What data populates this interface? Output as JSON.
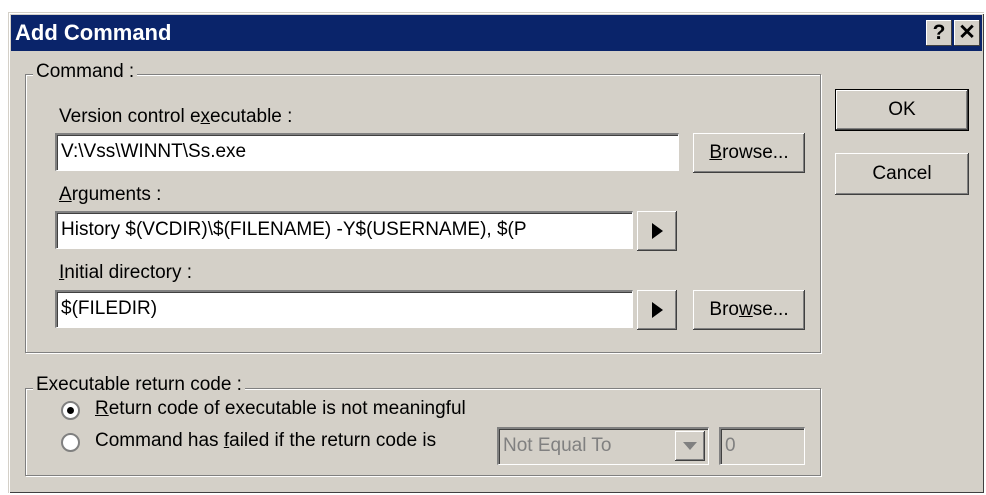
{
  "window": {
    "title": "Add Command"
  },
  "titlebar": {
    "help_glyph": "?",
    "close_glyph": "✕"
  },
  "command_group": {
    "legend": "Command :",
    "exe_label_pre": "Version control e",
    "exe_label_mn": "x",
    "exe_label_post": "ecutable :",
    "exe_value": "V:\\Vss\\WINNT\\Ss.exe",
    "browse1_mn": "B",
    "browse1_post": "rowse...",
    "args_label_mn": "A",
    "args_label_post": "rguments :",
    "args_value": "History $(VCDIR)\\$(FILENAME) -Y$(USERNAME), $(P",
    "initdir_label_mn": "I",
    "initdir_label_post": "nitial directory :",
    "initdir_value": "$(FILEDIR)",
    "browse2_pre": "Bro",
    "browse2_mn": "w",
    "browse2_post": "se..."
  },
  "buttons": {
    "ok": "OK",
    "cancel": "Cancel"
  },
  "return_group": {
    "legend": "Executable return code :",
    "radio1_mn": "R",
    "radio1_post": "eturn code of executable is not meaningful",
    "radio2_pre": "Command has ",
    "radio2_mn": "f",
    "radio2_post": "ailed if the return code is",
    "compare_selected": "Not Equal To",
    "code_value": "0",
    "selected_option": "radio1"
  }
}
